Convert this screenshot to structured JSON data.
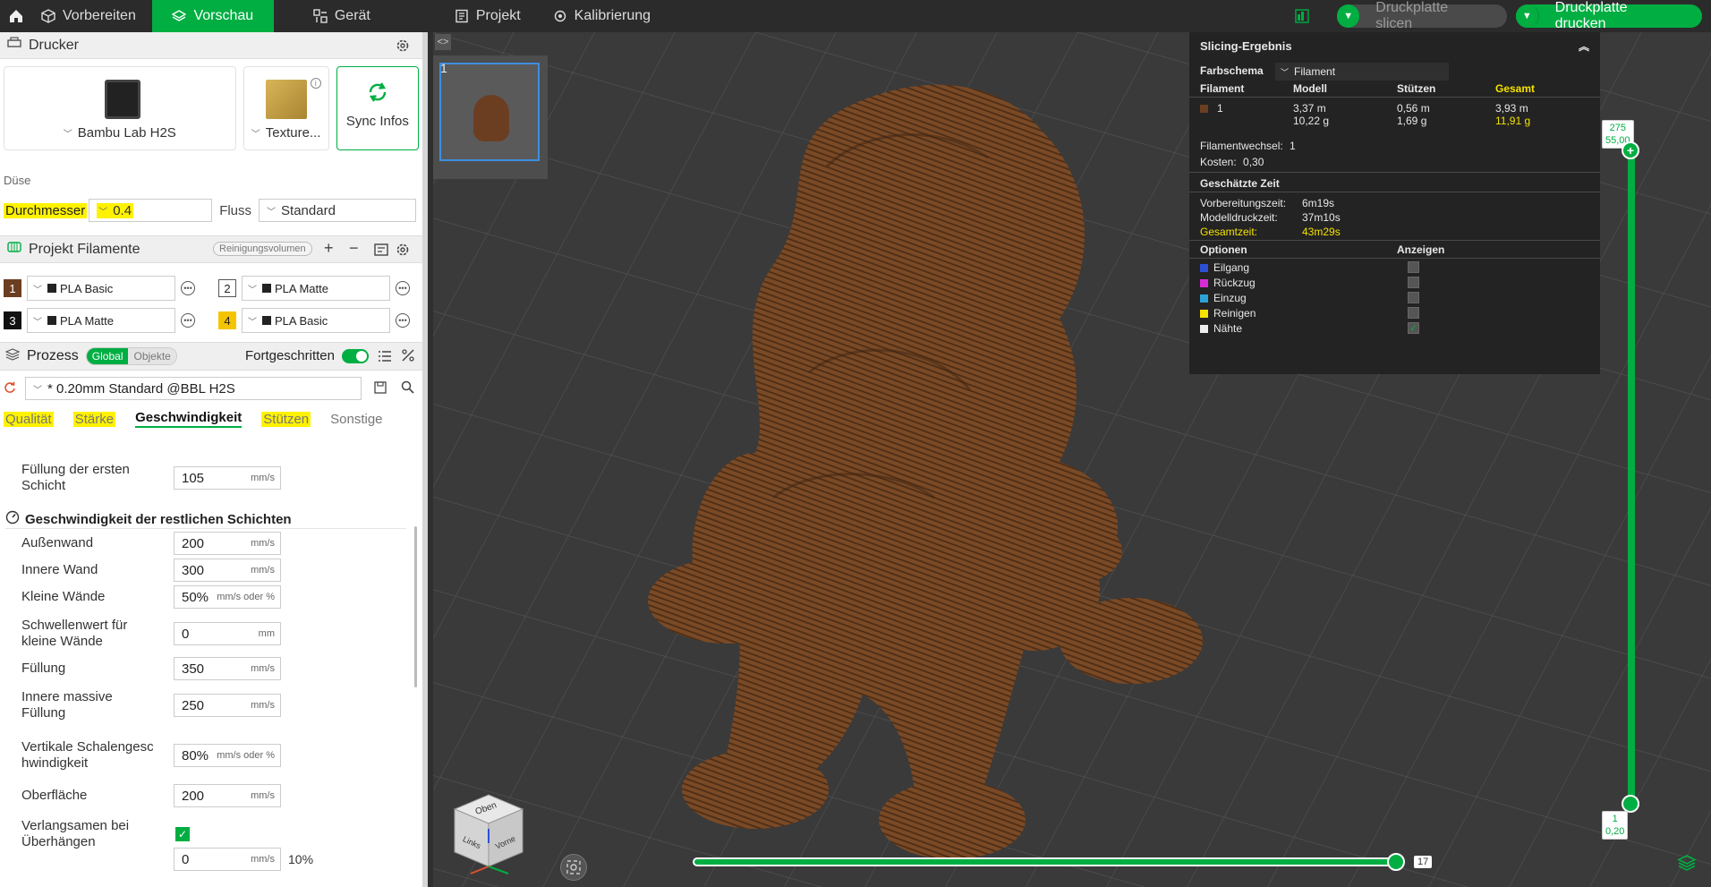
{
  "topbar": {
    "tabs": [
      {
        "label": "Vorbereiten"
      },
      {
        "label": "Vorschau"
      },
      {
        "label": "Gerät"
      },
      {
        "label": "Projekt"
      },
      {
        "label": "Kalibrierung"
      }
    ],
    "slice_button": "Druckplatte slicen",
    "print_button": "Druckplatte drucken"
  },
  "printer": {
    "section_title": "Drucker",
    "printer_name": "Bambu Lab H2S",
    "plate_type": "Texture...",
    "sync_label": "Sync Infos",
    "nozzle_label": "Düse",
    "diameter_label": "Durchmesser",
    "diameter_value": "0.4",
    "flow_label": "Fluss",
    "flow_value": "Standard"
  },
  "filaments": {
    "section_title": "Projekt Filamente",
    "purge_button": "Reinigungsvolumen",
    "items": [
      {
        "num": "1",
        "name": "PLA Basic",
        "color": "#6b3e22"
      },
      {
        "num": "2",
        "name": "PLA Matte",
        "color": "#ffffff"
      },
      {
        "num": "3",
        "name": "PLA Matte",
        "color": "#111111"
      },
      {
        "num": "4",
        "name": "PLA Basic",
        "color": "#f5c400"
      }
    ]
  },
  "process": {
    "section_title": "Prozess",
    "toggle_global": "Global",
    "toggle_objects": "Objekte",
    "advanced_label": "Fortgeschritten",
    "preset": "* 0.20mm Standard @BBL H2S",
    "tabs": [
      "Qualität",
      "Stärke",
      "Geschwindigkeit",
      "Stützen",
      "Sonstige"
    ]
  },
  "settings": {
    "first_layer_infill_label": "Füllung der ersten Schicht",
    "first_layer_infill_value": "105",
    "unit_mms": "mm/s",
    "unit_mm": "mm",
    "unit_mms_pct": "mm/s oder %",
    "group_title": "Geschwindigkeit der restlichen Schichten",
    "rows": [
      {
        "label": "Außenwand",
        "value": "200"
      },
      {
        "label": "Innere Wand",
        "value": "300"
      },
      {
        "label": "Kleine Wände",
        "value": "50%"
      },
      {
        "label": "Schwellenwert für kleine Wände",
        "value": "0"
      },
      {
        "label": "Füllung",
        "value": "350"
      },
      {
        "label": "Innere massive Füllung",
        "value": "250"
      },
      {
        "label": "Vertikale Schalengeschwindigkeit",
        "value": "80%"
      },
      {
        "label": "Oberfläche",
        "value": "200"
      },
      {
        "label": "Verlangsamen bei Überhängen"
      }
    ],
    "last_value": "0",
    "last_percent": "10%"
  },
  "viewport": {
    "plate_number": "1",
    "result": {
      "title": "Slicing-Ergebnis",
      "scheme_label": "Farbschema",
      "scheme_value": "Filament",
      "col_filament": "Filament",
      "col_model": "Modell",
      "col_support": "Stützen",
      "col_total": "Gesamt",
      "fil_num": "1",
      "model_len": "3,37 m",
      "model_weight": "10,22 g",
      "support_len": "0,56 m",
      "support_weight": "1,69 g",
      "total_len": "3,93 m",
      "total_weight": "11,91 g",
      "changes_label": "Filamentwechsel:",
      "changes_value": "1",
      "cost_label": "Kosten:",
      "cost_value": "0,30",
      "time_title": "Geschätzte Zeit",
      "prep_label": "Vorbereitungszeit:",
      "prep_value": "6m19s",
      "model_time_label": "Modelldruckzeit:",
      "model_time_value": "37m10s",
      "total_time_label": "Gesamtzeit:",
      "total_time_value": "43m29s",
      "options_label": "Optionen",
      "show_label": "Anzeigen",
      "options": [
        {
          "label": "Eilgang",
          "color": "#2c4fd6",
          "checked": false
        },
        {
          "label": "Rückzug",
          "color": "#d62cd6",
          "checked": false
        },
        {
          "label": "Einzug",
          "color": "#2ca3d6",
          "checked": false
        },
        {
          "label": "Reinigen",
          "color": "#f5e200",
          "checked": false
        },
        {
          "label": "Nähte",
          "color": "#eeeeee",
          "checked": true
        }
      ]
    },
    "layer_top_1": "275",
    "layer_top_2": "55,00",
    "layer_bottom_1": "1",
    "layer_bottom_2": "0,20",
    "move_label": "17",
    "cube_top": "Oben",
    "cube_left": "Links",
    "cube_front": "Vorne"
  }
}
